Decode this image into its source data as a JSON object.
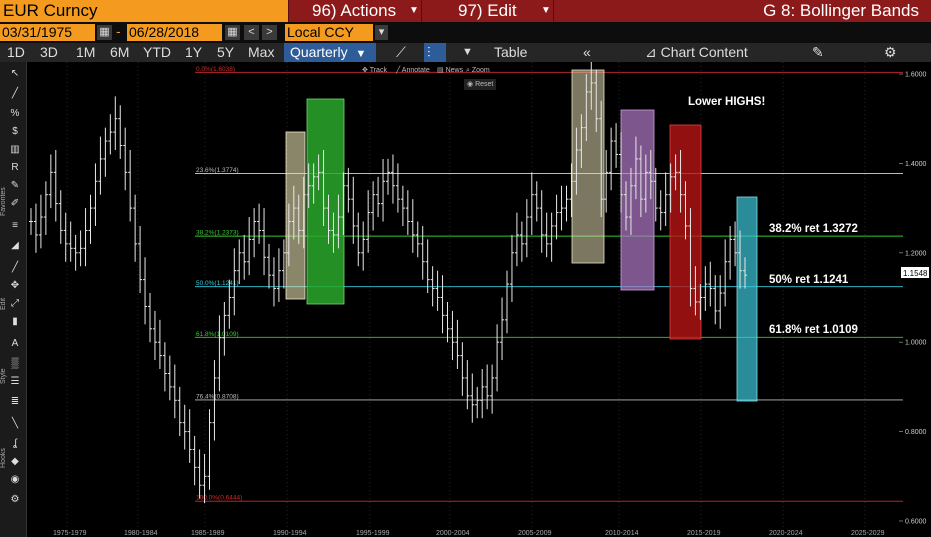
{
  "header": {
    "security": "EUR Curncy",
    "actions_label": "96) Actions",
    "edit_label": "97) Edit",
    "function_title": "G 8: Bollinger Bands"
  },
  "dates": {
    "start": "03/31/1975",
    "end": "06/28/2018",
    "currency": "Local CCY"
  },
  "periods": [
    "1D",
    "3D",
    "1M",
    "6M",
    "YTD",
    "1Y",
    "5Y",
    "Max"
  ],
  "frequency": "Quarterly",
  "toolbar_right": {
    "table_label": "Table",
    "chart_content_label": "Chart Content"
  },
  "mini_toolbar": {
    "track": "Track",
    "annotate": "Annotate",
    "news": "News",
    "zoom": "Zoom",
    "reset": "Reset"
  },
  "sidebar_labels": {
    "favorites": "Favorites",
    "edit": "Edit",
    "style": "Style",
    "hooks": "Hooks"
  },
  "colors": {
    "orange": "#f49b1f",
    "darkred": "#8c1a1a",
    "active_tab": "#2e5c99"
  },
  "chart_data": {
    "type": "ohlc",
    "x_labels": [
      "1975-1979",
      "1980-1984",
      "1985-1989",
      "1990-1994",
      "1995-1999",
      "2000-2004",
      "2005-2009",
      "2010-2014",
      "2015-2019",
      "2020-2024",
      "2025-2029"
    ],
    "y_ticks": [
      "1.6000",
      "1.4000",
      "1.2000",
      "1.1548",
      "1.0000",
      "0.8000",
      "0.6000"
    ],
    "last_price": "1.1548",
    "fib_levels": [
      {
        "label": "0.0%(1.6038)",
        "value": 1.6038,
        "color": "#d42a2a"
      },
      {
        "label": "23.6%(1.3774)",
        "value": 1.3774,
        "color": "#bbbbbb"
      },
      {
        "label": "38.2%(1.2373)",
        "value": 1.2373,
        "color": "#33cc33"
      },
      {
        "label": "50.0%(1.1241)",
        "value": 1.1241,
        "color": "#33ccdd"
      },
      {
        "label": "61.8%(1.0109)",
        "value": 1.0109,
        "color": "#33cc33"
      },
      {
        "label": "76.4%(0.8708)",
        "value": 0.8708,
        "color": "#bbbbbb"
      },
      {
        "label": "100.0%(0.6444)",
        "value": 0.6444,
        "color": "#d42a2a"
      }
    ],
    "annotations": {
      "lower_highs": "Lower HIGHS!",
      "ret382": "38.2% ret 1.3272",
      "ret50": "50% ret 1.1241",
      "ret618": "61.8% ret 1.0109"
    },
    "series_closes": [
      1.27,
      1.24,
      1.28,
      1.33,
      1.38,
      1.31,
      1.25,
      1.22,
      1.21,
      1.2,
      1.21,
      1.25,
      1.3,
      1.36,
      1.41,
      1.45,
      1.47,
      1.5,
      1.44,
      1.38,
      1.3,
      1.22,
      1.14,
      1.08,
      1.03,
      1.0,
      0.97,
      0.93,
      0.9,
      0.87,
      0.82,
      0.8,
      0.76,
      0.72,
      0.68,
      0.7,
      0.82,
      0.92,
      1.01,
      1.06,
      1.1,
      1.16,
      1.2,
      1.18,
      1.23,
      1.27,
      1.25,
      1.19,
      1.15,
      1.12,
      1.16,
      1.2,
      1.27,
      1.3,
      1.25,
      1.33,
      1.35,
      1.37,
      1.38,
      1.3,
      1.25,
      1.24,
      1.28,
      1.35,
      1.32,
      1.26,
      1.2,
      1.23,
      1.29,
      1.33,
      1.31,
      1.36,
      1.38,
      1.35,
      1.32,
      1.3,
      1.27,
      1.24,
      1.22,
      1.18,
      1.14,
      1.12,
      1.1,
      1.06,
      1.03,
      1.0,
      0.97,
      0.92,
      0.88,
      0.86,
      0.87,
      0.9,
      0.88,
      0.92,
      1.0,
      1.05,
      1.13,
      1.2,
      1.24,
      1.22,
      1.28,
      1.33,
      1.3,
      1.24,
      1.22,
      1.26,
      1.29,
      1.3,
      1.32,
      1.36,
      1.43,
      1.48,
      1.56,
      1.58,
      1.5,
      1.32,
      1.38,
      1.45,
      1.42,
      1.33,
      1.28,
      1.35,
      1.41,
      1.32,
      1.38,
      1.36,
      1.3,
      1.29,
      1.33,
      1.37,
      1.38,
      1.33,
      1.26,
      1.12,
      1.09,
      1.1,
      1.13,
      1.12,
      1.07,
      1.11,
      1.18,
      1.23,
      1.2,
      1.16,
      1.15
    ]
  }
}
